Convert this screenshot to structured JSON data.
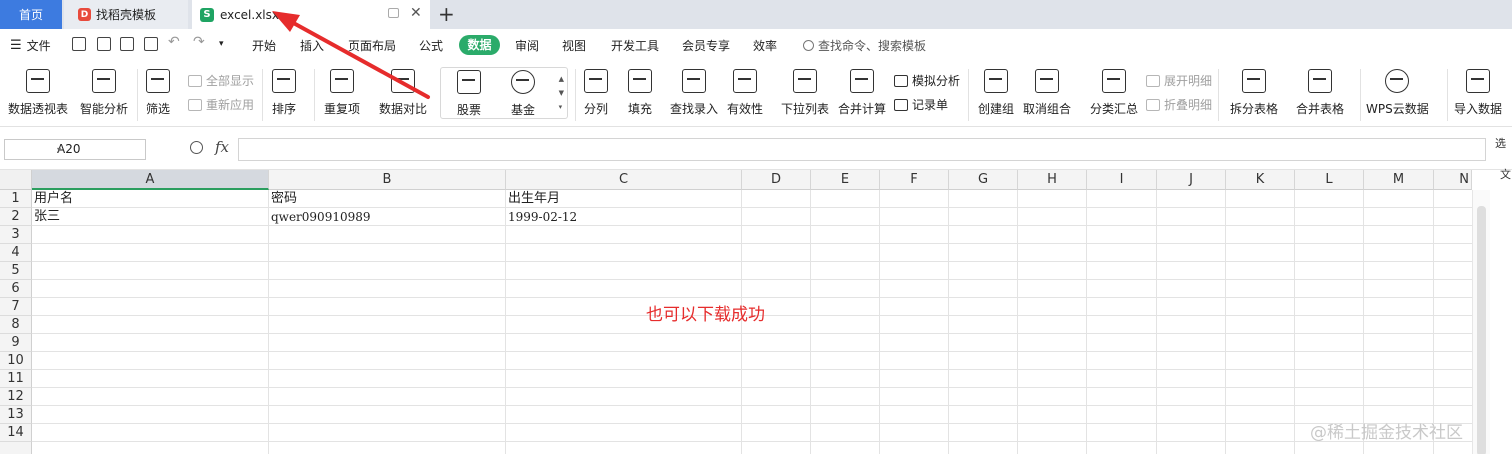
{
  "tabs": {
    "home": "首页",
    "templates": "找稻壳模板",
    "file": "excel.xlsx",
    "add_icon": "plus-icon"
  },
  "menu": {
    "file": "文件",
    "items": [
      "开始",
      "插入",
      "页面布局",
      "公式",
      "数据",
      "审阅",
      "视图",
      "开发工具",
      "会员专享",
      "效率"
    ],
    "active": "数据",
    "search_placeholder": "查找命令、搜索模板",
    "accent_color": "#2bab6a"
  },
  "ribbon": {
    "pivot": "数据透视表",
    "smart_analysis": "智能分析",
    "filter": "筛选",
    "show_all": "全部显示",
    "reapply": "重新应用",
    "sort": "排序",
    "duplicates": "重复项",
    "compare": "数据对比",
    "stocks": "股票",
    "funds": "基金",
    "split": "分列",
    "fill": "填充",
    "lookup": "查找录入",
    "validity": "有效性",
    "dropdown": "下拉列表",
    "consolidate": "合并计算",
    "simulate": "模拟分析",
    "record": "记录单",
    "create_group": "创建组",
    "ungroup": "取消组合",
    "subtotal": "分类汇总",
    "expand": "展开明细",
    "collapse": "折叠明细",
    "split_table": "拆分表格",
    "merge_table": "合并表格",
    "wps_cloud": "WPS云数据",
    "import": "导入数据"
  },
  "formula_bar": {
    "name_box": "A20",
    "fx": "fx",
    "formula": "",
    "side_label_1": "选",
    "side_label_2": "文"
  },
  "sheet": {
    "columns": [
      "A",
      "B",
      "C",
      "D",
      "E",
      "F",
      "G",
      "H",
      "I",
      "J",
      "K",
      "L",
      "M",
      "N"
    ],
    "selected_column": "A",
    "rows": [
      "1",
      "2",
      "3",
      "4",
      "5",
      "6",
      "7",
      "8",
      "9",
      "10",
      "11",
      "12",
      "13",
      "14"
    ],
    "cells": {
      "A1": "用户名",
      "B1": "密码",
      "C1": "出生年月",
      "A2": "张三",
      "B2": "qwer090910989",
      "C2": "1999-02-12"
    }
  },
  "annotation": {
    "note": "也可以下载成功",
    "arrow_color": "#e62c2c"
  },
  "watermark": "@稀土掘金技术社区"
}
